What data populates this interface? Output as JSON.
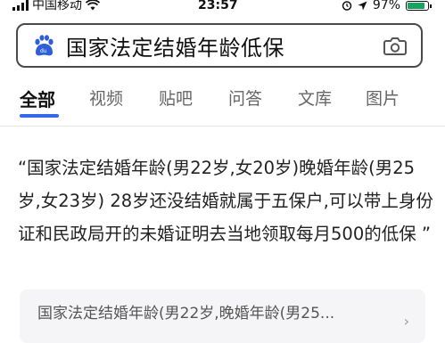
{
  "status_bar": {
    "carrier": "中国移动",
    "time": "23:57",
    "battery_percent": "97%",
    "battery_level": 0.97,
    "icons": [
      "signal-icon",
      "wifi-icon",
      "alarm-icon",
      "location-icon",
      "battery-icon"
    ]
  },
  "search": {
    "query": "国家法定结婚年龄低保",
    "logo_icon": "baidu-paw-icon",
    "camera_icon": "camera-icon"
  },
  "tabs": [
    {
      "label": "全部",
      "active": true
    },
    {
      "label": "视频",
      "active": false
    },
    {
      "label": "贴吧",
      "active": false
    },
    {
      "label": "问答",
      "active": false
    },
    {
      "label": "文库",
      "active": false
    },
    {
      "label": "图片",
      "active": false
    }
  ],
  "result": {
    "snippet": "“国家法定结婚年龄(男22岁,女20岁)晚婚年龄(男25岁,女23岁) 28岁还没结婚就属于五保户,可以带上身份证和民政局开的未婚证明去当地领取每月500的低保 ”"
  },
  "next_result": {
    "text": "国家法定结婚年龄(男22岁,晚婚年龄(男25...",
    "chevron": "›"
  },
  "colors": {
    "accent": "#3369e8",
    "battery": "#1aa260",
    "paw": "#2f5fd8"
  }
}
